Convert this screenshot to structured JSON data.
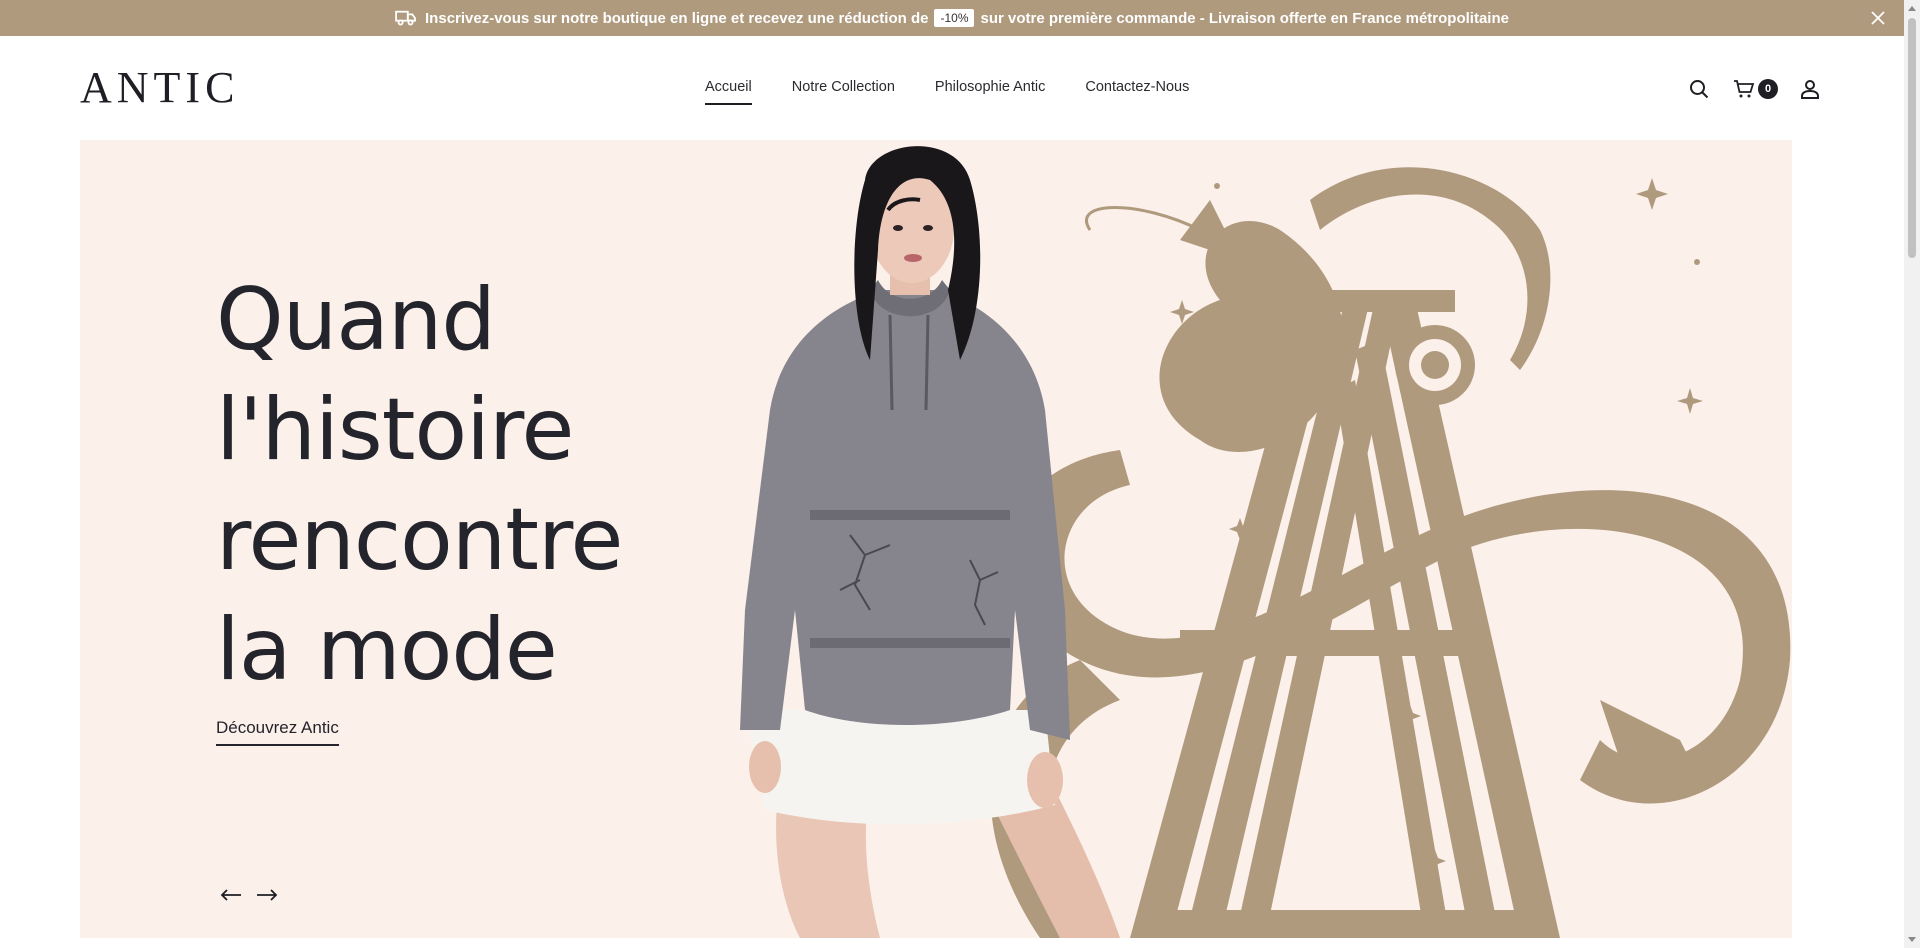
{
  "announcement": {
    "text_before": "Inscrivez-vous sur notre boutique en ligne et recevez une réduction de",
    "discount": "-10%",
    "text_after": "sur votre première commande - Livraison offerte en France métropolitaine",
    "icon": "delivery-truck-icon",
    "close_icon": "close-icon"
  },
  "header": {
    "logo": "ANTIC",
    "nav": [
      {
        "label": "Accueil",
        "active": true
      },
      {
        "label": "Notre Collection",
        "active": false
      },
      {
        "label": "Philosophie Antic",
        "active": false
      },
      {
        "label": "Contactez-Nous",
        "active": false
      }
    ],
    "cart_count": "0",
    "icons": [
      "search-icon",
      "cart-icon",
      "account-icon"
    ]
  },
  "hero": {
    "title_lines": [
      "Quand",
      "l'histoire",
      "rencontre",
      "la mode"
    ],
    "cta_label": "Découvrez Antic",
    "prev_icon": "arrow-left-icon",
    "next_icon": "arrow-right-icon"
  },
  "colors": {
    "accent": "#b09a7e",
    "hero_bg": "#fbf0ea",
    "text": "#1e1e24"
  }
}
